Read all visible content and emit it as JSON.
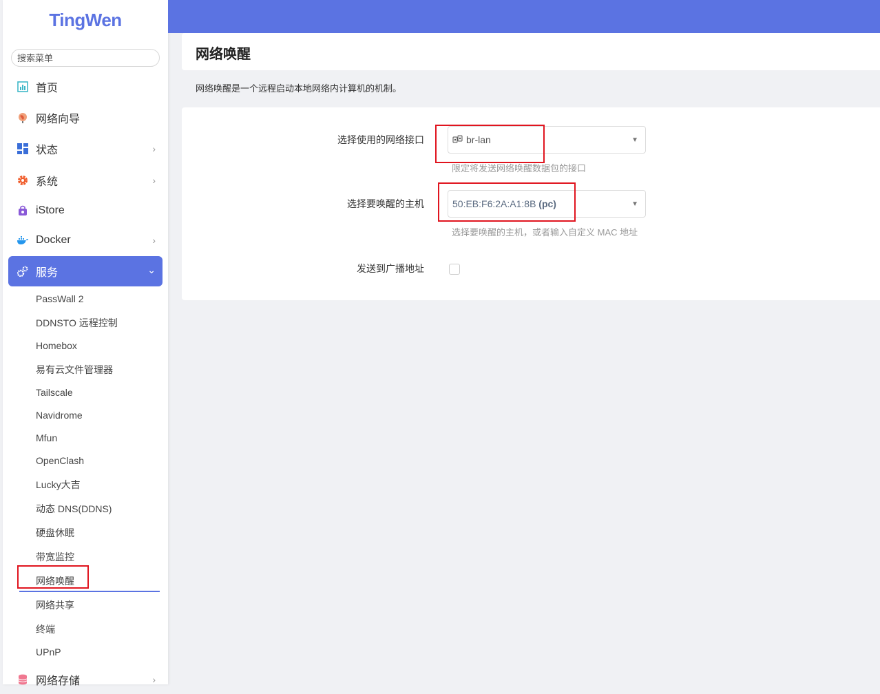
{
  "app": {
    "logo": "TingWen"
  },
  "sidebar": {
    "search_placeholder": "搜索菜单",
    "items": [
      {
        "label": "首页",
        "icon": "dashboard-icon"
      },
      {
        "label": "网络向导",
        "icon": "globe-icon"
      },
      {
        "label": "状态",
        "icon": "grid-icon"
      },
      {
        "label": "系统",
        "icon": "gear-icon"
      },
      {
        "label": "iStore",
        "icon": "store-icon"
      },
      {
        "label": "Docker",
        "icon": "docker-icon"
      },
      {
        "label": "服务",
        "icon": "services-icon"
      },
      {
        "label": "网络存储",
        "icon": "storage-icon"
      }
    ],
    "sub_items": [
      "PassWall 2",
      "DDNSTO 远程控制",
      "Homebox",
      "易有云文件管理器",
      "Tailscale",
      "Navidrome",
      "Mfun",
      "OpenClash",
      "Lucky大吉",
      "动态 DNS(DDNS)",
      "硬盘休眠",
      "带宽监控",
      "网络唤醒",
      "网络共享",
      "终端",
      "UPnP"
    ]
  },
  "page": {
    "title": "网络唤醒",
    "description": "网络唤醒是一个远程启动本地网络内计算机的机制。"
  },
  "form": {
    "interface": {
      "label": "选择使用的网络接口",
      "value": "br-lan",
      "hint": "限定将发送网络唤醒数据包的接口"
    },
    "host": {
      "label": "选择要唤醒的主机",
      "value": "50:EB:F6:2A:A1:8B",
      "value_suffix": "(pc)",
      "hint": "选择要唤醒的主机，或者输入自定义 MAC 地址"
    },
    "broadcast": {
      "label": "发送到广播地址",
      "checked": false
    }
  },
  "colors": {
    "accent": "#5b73e2",
    "highlight": "#e0141e"
  }
}
